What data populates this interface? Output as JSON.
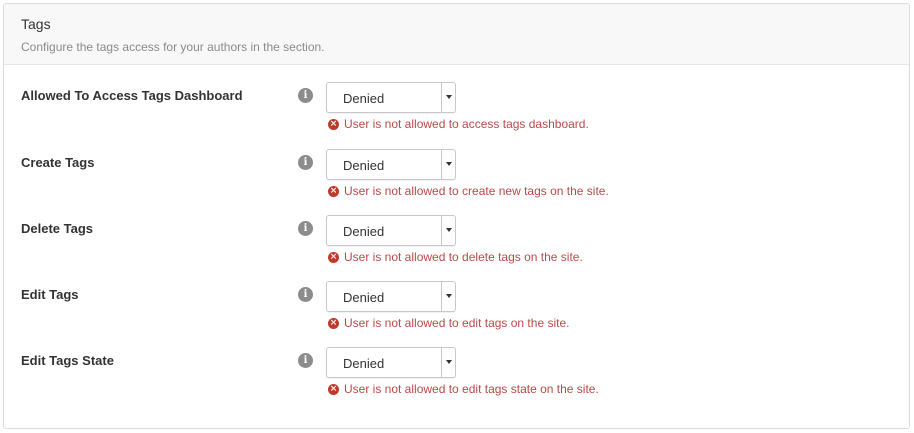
{
  "section": {
    "title": "Tags",
    "description": "Configure the tags access for your authors in the section."
  },
  "icons": {
    "info": "info-icon",
    "error": "error-icon",
    "dropdown": "chevron-down-icon"
  },
  "colors": {
    "error_text": "#b94a48",
    "error_icon": "#c0392b",
    "info_icon": "#8c8c8c",
    "header_bg": "#f8f8f8"
  },
  "rows": [
    {
      "label": "Allowed To Access Tags Dashboard",
      "value": "Denied",
      "message": "User is not allowed to access tags dashboard."
    },
    {
      "label": "Create Tags",
      "value": "Denied",
      "message": "User is not allowed to create new tags on the site."
    },
    {
      "label": "Delete Tags",
      "value": "Denied",
      "message": "User is not allowed to delete tags on the site."
    },
    {
      "label": "Edit Tags",
      "value": "Denied",
      "message": "User is not allowed to edit tags on the site."
    },
    {
      "label": "Edit Tags State",
      "value": "Denied",
      "message": "User is not allowed to edit tags state on the site."
    }
  ]
}
